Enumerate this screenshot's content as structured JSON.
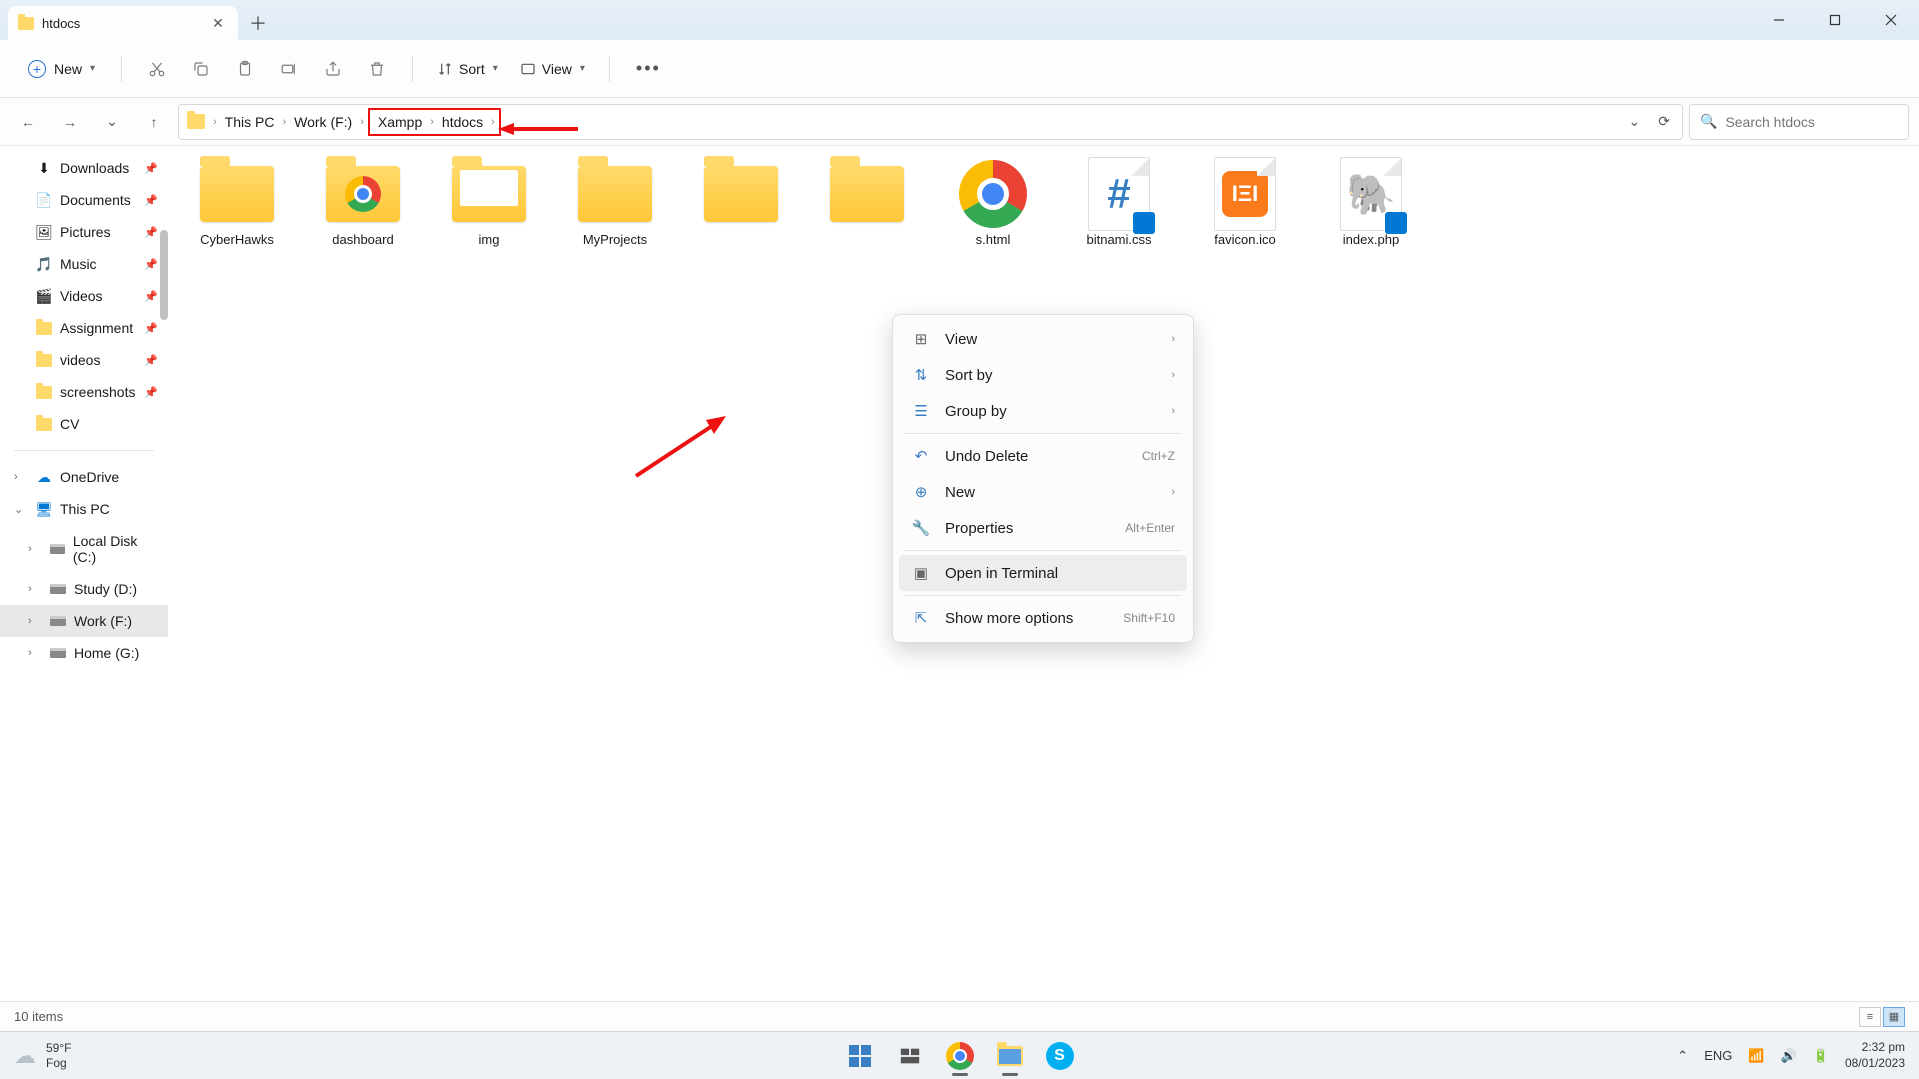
{
  "tab": {
    "title": "htdocs"
  },
  "toolbar": {
    "new_label": "New",
    "sort_label": "Sort",
    "view_label": "View"
  },
  "breadcrumbs": [
    "This PC",
    "Work (F:)",
    "Xampp",
    "htdocs"
  ],
  "search": {
    "placeholder": "Search htdocs"
  },
  "sidebar": {
    "quick": [
      {
        "label": "Downloads",
        "icon": "download",
        "pinned": true
      },
      {
        "label": "Documents",
        "icon": "doc",
        "pinned": true
      },
      {
        "label": "Pictures",
        "icon": "pic",
        "pinned": true
      },
      {
        "label": "Music",
        "icon": "music",
        "pinned": true
      },
      {
        "label": "Videos",
        "icon": "video",
        "pinned": true
      },
      {
        "label": "Assignment",
        "icon": "folder",
        "pinned": true
      },
      {
        "label": "videos",
        "icon": "folder",
        "pinned": true
      },
      {
        "label": "screenshots",
        "icon": "folder",
        "pinned": true
      },
      {
        "label": "CV",
        "icon": "folder",
        "pinned": false
      }
    ],
    "onedrive": "OneDrive",
    "thispc": "This PC",
    "drives": [
      {
        "label": "Local Disk (C:)"
      },
      {
        "label": "Study (D:)"
      },
      {
        "label": "Work (F:)"
      },
      {
        "label": "Home (G:)"
      }
    ]
  },
  "items": [
    {
      "label": "CyberHawks",
      "type": "folder"
    },
    {
      "label": "dashboard",
      "type": "folder-chrome"
    },
    {
      "label": "img",
      "type": "folder-content"
    },
    {
      "label": "MyProjects",
      "type": "folder"
    },
    {
      "label": "",
      "type": "folder"
    },
    {
      "label": "",
      "type": "folder"
    },
    {
      "label": "s.html",
      "type": "chrome"
    },
    {
      "label": "bitnami.css",
      "type": "css"
    },
    {
      "label": "favicon.ico",
      "type": "xampp"
    },
    {
      "label": "index.php",
      "type": "php"
    }
  ],
  "context_menu": {
    "view": "View",
    "sort_by": "Sort by",
    "group_by": "Group by",
    "undo_delete": "Undo Delete",
    "undo_shortcut": "Ctrl+Z",
    "new": "New",
    "properties": "Properties",
    "properties_shortcut": "Alt+Enter",
    "open_terminal": "Open in Terminal",
    "show_more": "Show more options",
    "show_more_shortcut": "Shift+F10"
  },
  "status": {
    "count": "10 items"
  },
  "taskbar": {
    "temp": "59°F",
    "weather": "Fog",
    "lang": "ENG",
    "time": "2:32 pm",
    "date": "08/01/2023"
  }
}
